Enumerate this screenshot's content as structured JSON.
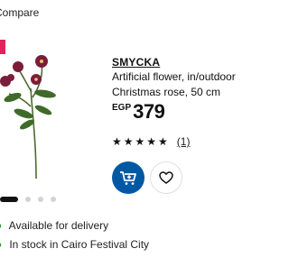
{
  "header": {
    "compare_label": "Compare"
  },
  "product": {
    "name": "SMYCKA",
    "description_line1": "Artificial flower, in/outdoor",
    "description_line2": "Christmas rose, 50 cm",
    "currency": "EGP",
    "price": "379",
    "rating_stars": "★★★★★",
    "rating_count": "(1)"
  },
  "gallery": {
    "total_images": 4,
    "active_index": 0
  },
  "availability": {
    "delivery_text": "Available for delivery",
    "store_text": "In stock in Cairo Festival City"
  },
  "colors": {
    "accent": "#0058a3",
    "badge": "#e0245e",
    "flower": "#7b1d3a"
  }
}
